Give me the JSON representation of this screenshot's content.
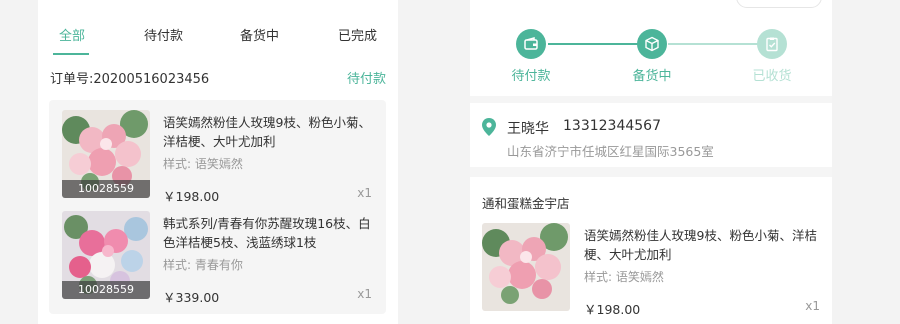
{
  "left": {
    "tabs": [
      {
        "label": "全部",
        "active": true
      },
      {
        "label": "待付款",
        "active": false
      },
      {
        "label": "备货中",
        "active": false
      },
      {
        "label": "已完成",
        "active": false
      }
    ],
    "order": {
      "number": "订单号:20200516023456",
      "status": "待付款",
      "items": [
        {
          "name": "语笑嫣然粉佳人玫瑰9枝、粉色小菊、洋桔梗、大叶尤加利",
          "style": "样式: 语笑嫣然",
          "price": "￥198.00",
          "qty": "x1",
          "sku": "10028559"
        },
        {
          "name": "韩式系列/青春有你苏醒玫瑰16枝、白色洋桔梗5枝、浅蓝绣球1枝",
          "style": "样式: 青春有你",
          "price": "￥339.00",
          "qty": "x1",
          "sku": "10028559"
        }
      ]
    }
  },
  "right": {
    "steps": [
      {
        "label": "待付款",
        "icon": "wallet-icon",
        "done": true
      },
      {
        "label": "备货中",
        "icon": "package-icon",
        "done": true
      },
      {
        "label": "已收货",
        "icon": "clipboard-check-icon",
        "done": false
      }
    ],
    "address": {
      "name": "王晓华",
      "phone": "13312344567",
      "detail": "山东省济宁市任城区红星国际3565室"
    },
    "shop": {
      "name": "通和蛋糕金宇店",
      "item": {
        "name": "语笑嫣然粉佳人玫瑰9枝、粉色小菊、洋桔梗、大叶尤加利",
        "style": "样式: 语笑嫣然",
        "price": "￥198.00",
        "qty": "x1"
      }
    }
  },
  "colors": {
    "accent": "#4cb59a",
    "accent_light": "#b5e1d4",
    "muted": "#999999"
  }
}
